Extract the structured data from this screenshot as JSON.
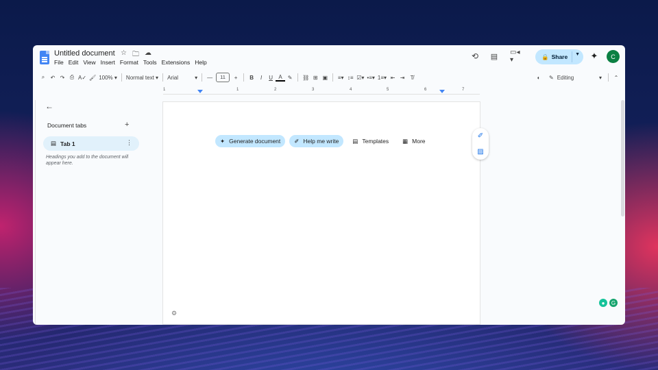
{
  "window": {
    "doc_title": "Untitled document",
    "menu": [
      "File",
      "Edit",
      "View",
      "Insert",
      "Format",
      "Tools",
      "Extensions",
      "Help"
    ],
    "share_label": "Share",
    "avatar_initial": "C"
  },
  "toolbar": {
    "zoom": "100%",
    "style": "Normal text",
    "font": "Arial",
    "font_size": "11",
    "mode": "Editing"
  },
  "ruler": {
    "marks": [
      "1",
      "1",
      "2",
      "3",
      "4",
      "5",
      "6",
      "7"
    ]
  },
  "sidebar": {
    "section_title": "Document tabs",
    "tab_label": "Tab 1",
    "hint": "Headings you add to the document will appear here."
  },
  "chips": {
    "generate": "Generate document",
    "help": "Help me write",
    "templates": "Templates",
    "more": "More"
  },
  "colors": {
    "accent": "#1a73e8",
    "share_bg": "#c2e7ff",
    "avatar": "#0b8043"
  }
}
